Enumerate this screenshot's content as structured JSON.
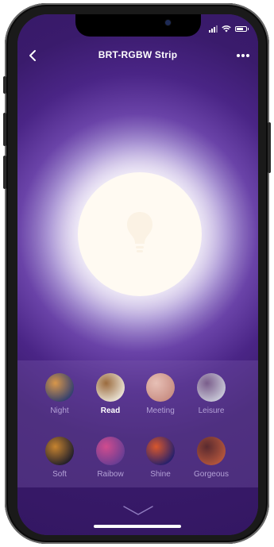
{
  "header": {
    "title": "BRT-RGBW Strip",
    "back_icon": "chevron-left-icon",
    "more_icon": "more-dots-icon"
  },
  "status_bar": {
    "icons": [
      "signal-icon",
      "wifi-icon",
      "battery-icon"
    ]
  },
  "light": {
    "icon": "bulb-icon",
    "color": "#fffaf2",
    "state": "on"
  },
  "scenes": [
    {
      "label": "Night",
      "active": false,
      "colors": [
        "#34406e",
        "#d8974a"
      ]
    },
    {
      "label": "Read",
      "active": true,
      "colors": [
        "#e9e1d2",
        "#9b6b3e"
      ]
    },
    {
      "label": "Meeting",
      "active": false,
      "colors": [
        "#c98f84",
        "#e7c0b6"
      ]
    },
    {
      "label": "Leisure",
      "active": false,
      "colors": [
        "#c7c6d6",
        "#7a5d8b"
      ]
    },
    {
      "label": "Soft",
      "active": false,
      "colors": [
        "#23202a",
        "#c7842f"
      ]
    },
    {
      "label": "Raibow",
      "active": false,
      "colors": [
        "#6a3d93",
        "#d14c8e"
      ]
    },
    {
      "label": "Shine",
      "active": false,
      "colors": [
        "#27206b",
        "#d9572c"
      ]
    },
    {
      "label": "Gorgeous",
      "active": false,
      "colors": [
        "#b2553c",
        "#5a2a2f"
      ]
    }
  ],
  "footer": {
    "collapse_icon": "chevron-down-icon"
  },
  "theme": {
    "background": "#3b1b6a",
    "label_inactive": "#b3a1d6",
    "label_active": "#ffffff"
  }
}
